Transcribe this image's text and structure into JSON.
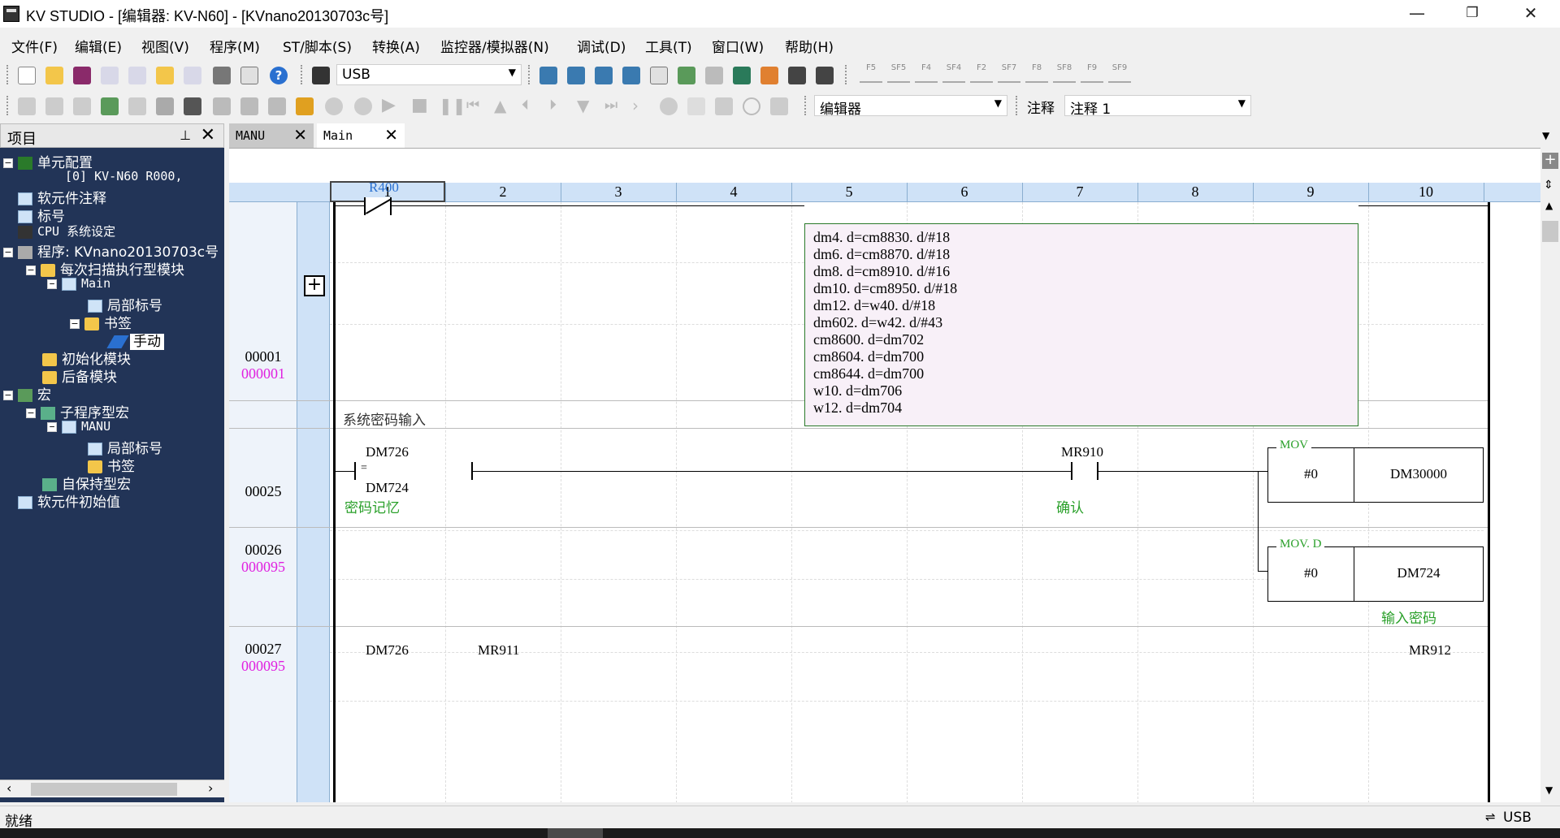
{
  "window": {
    "title": "KV STUDIO - [编辑器: KV-N60] - [KVnano20130703c号]",
    "minimize": "—",
    "restore": "❐",
    "close": "✕"
  },
  "menu": [
    "文件(F)",
    "编辑(E)",
    "视图(V)",
    "程序(M)",
    "ST/脚本(S)",
    "转换(A)",
    "监控器/模拟器(N)",
    "调试(D)",
    "工具(T)",
    "窗口(W)",
    "帮助(H)"
  ],
  "toolbar1": {
    "connection_value": "USB",
    "fkeys": [
      "F5",
      "SF5",
      "F4",
      "SF4",
      "F2",
      "SF7",
      "F8",
      "SF8",
      "F9",
      "SF9"
    ]
  },
  "toolbar2": {
    "mode_value": "编辑器",
    "comment_label": "注释",
    "comment_value": "注释 1"
  },
  "project": {
    "header": "项目",
    "pin": "⊥",
    "close": "✕",
    "tree": [
      "单元配置",
      "[0]  KV-N60         R000,",
      "软元件注释",
      "标号",
      "CPU 系统设定",
      "程序: KVnano20130703c号",
      "每次扫描执行型模块",
      "Main",
      "局部标号",
      "书签",
      "手动",
      "初始化模块",
      "后备模块",
      "宏",
      "子程序型宏",
      "MANU",
      "局部标号",
      "书签",
      "自保持型宏",
      "软元件初始值"
    ]
  },
  "tabs": [
    {
      "label": "MANU",
      "close": "✕"
    },
    {
      "label": "Main",
      "close": "✕"
    }
  ],
  "editor": {
    "columns": [
      "1",
      "2",
      "3",
      "4",
      "5",
      "6",
      "7",
      "8",
      "9",
      "10"
    ],
    "rows": [
      {
        "line": "00001",
        "step": "000001"
      },
      {
        "line": "00025",
        "step": ""
      },
      {
        "line": "00026",
        "step": "000095"
      },
      {
        "line": "00027",
        "step": "000095"
      }
    ],
    "expand": "+",
    "rung1": {
      "contact": "R400",
      "script_lines": [
        "dm4. d=cm8830. d/#18",
        "dm6. d=cm8870. d/#18",
        "dm8. d=cm8910. d/#16",
        "dm10. d=cm8950. d/#18",
        "dm12. d=w40. d/#18",
        "dm602. d=w42. d/#43",
        "cm8600. d=dm702",
        "cm8604. d=dm700",
        "cm8644. d=dm700",
        "w10. d=dm706",
        "w12. d=dm704"
      ]
    },
    "rung25": {
      "comment": "系统密码输入"
    },
    "rung26": {
      "cmp_top": "DM726",
      "cmp_op": "=",
      "cmp_bottom": "DM724",
      "cmp_comment": "密码记忆",
      "contact": "MR910",
      "contact_comment": "确认",
      "instr": "MOV",
      "src": "#0",
      "dst": "DM30000"
    },
    "rung27": {
      "instr": "MOV. D",
      "src": "#0",
      "dst": "DM724",
      "dst_comment": "输入密码"
    },
    "rung_next": {
      "a": "DM726",
      "b": "MR911",
      "c": "MR912"
    }
  },
  "status": {
    "left": "就绪",
    "right": "USB"
  }
}
